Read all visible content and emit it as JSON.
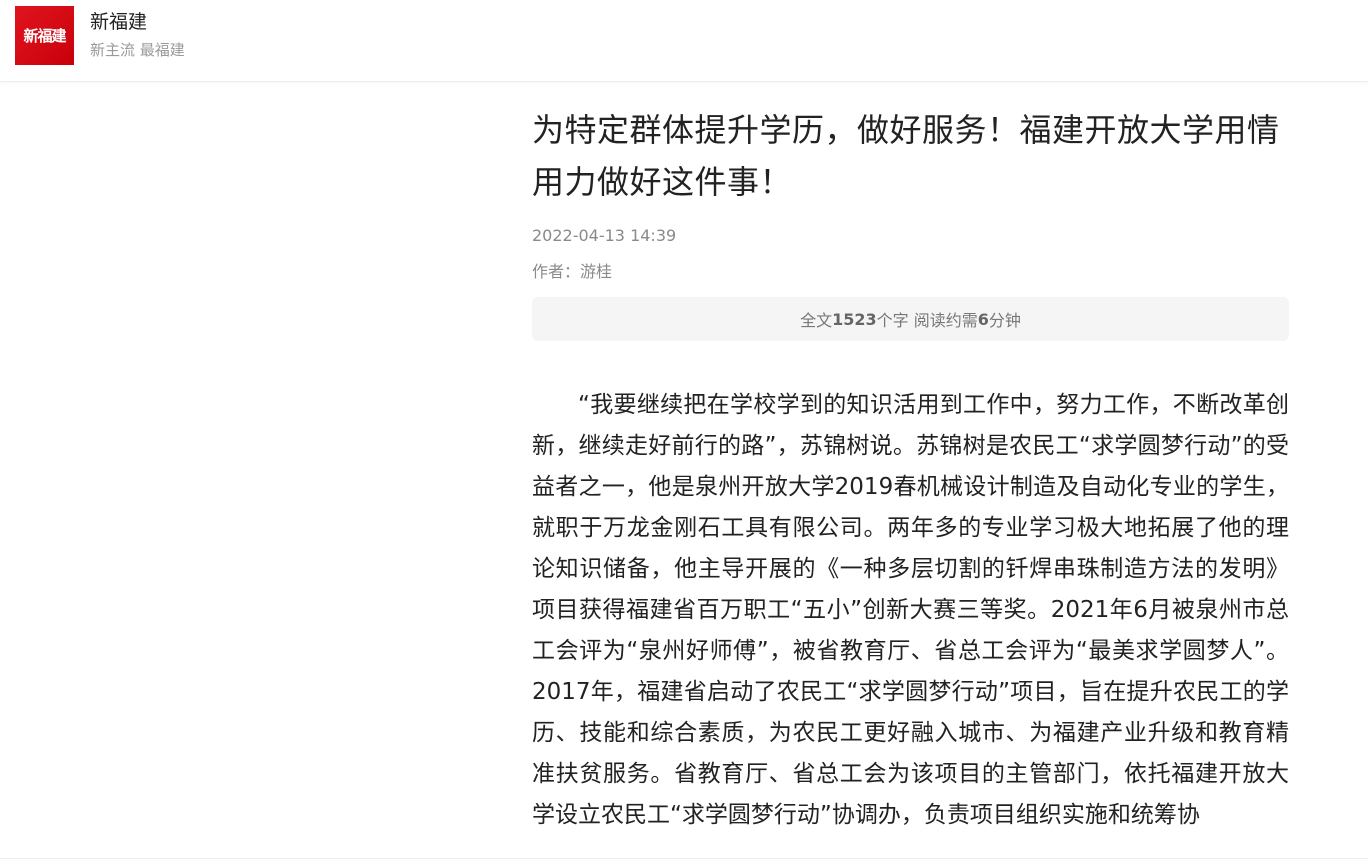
{
  "header": {
    "logo_text": "新福建",
    "brand_name": "新福建",
    "slogan": "新主流 最福建",
    "brand_color": "#d7141e"
  },
  "article": {
    "title": "为特定群体提升学历，做好服务！福建开放大学用情用力做好这件事！",
    "date": "2022-04-13 14:39",
    "author_label": "作者：",
    "author_name": "游桂",
    "summary": {
      "prefix": "全文",
      "char_count": "1523",
      "middle": "个字 阅读约需",
      "minutes": "6",
      "suffix": "分钟"
    },
    "paragraph": "“我要继续把在学校学到的知识活用到工作中，努力工作，不断改革创新，继续走好前行的路”，苏锦树说。苏锦树是农民工“求学圆梦行动”的受益者之一，他是泉州开放大学2019春机械设计制造及自动化专业的学生，就职于万龙金刚石工具有限公司。两年多的专业学习极大地拓展了他的理论知识储备，他主导开展的《一种多层切割的钎焊串珠制造方法的发明》项目获得福建省百万职工“五小”创新大赛三等奖。2021年6月被泉州市总工会评为“泉州好师傅”，被省教育厅、省总工会评为“最美求学圆梦人”。2017年，福建省启动了农民工“求学圆梦行动”项目，旨在提升农民工的学历、技能和综合素质，为农民工更好融入城市、为福建产业升级和教育精准扶贫服务。省教育厅、省总工会为该项目的主管部门，依托福建开放大学设立农民工“求学圆梦行动”协调办，负责项目组织实施和统筹协"
  }
}
